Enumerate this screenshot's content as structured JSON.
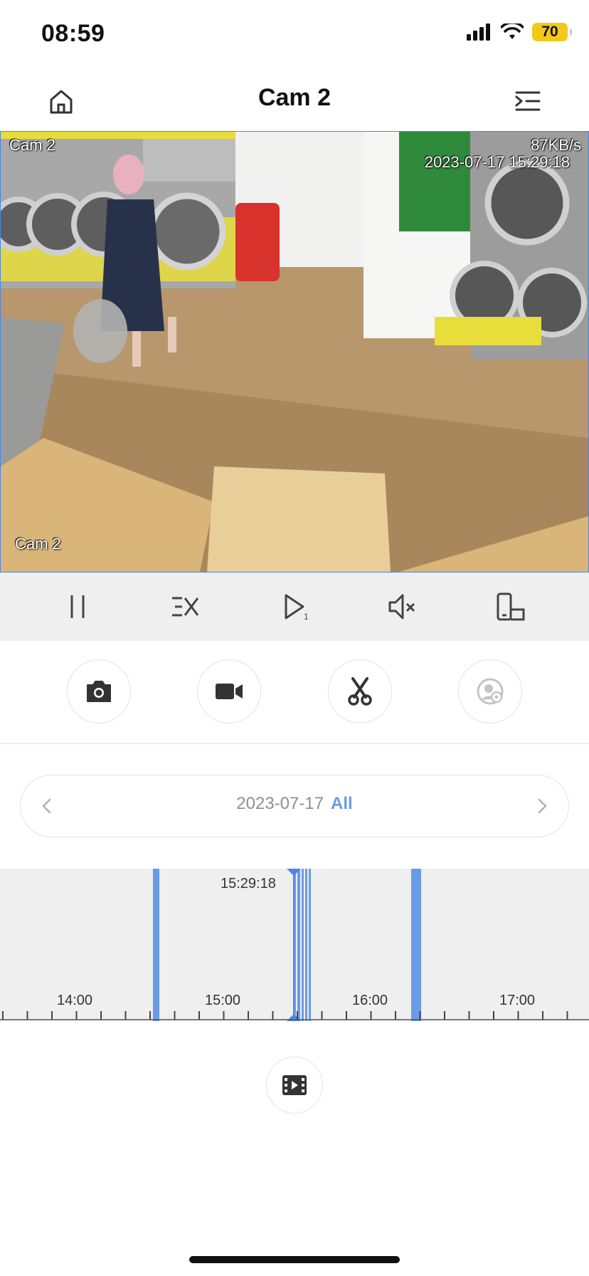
{
  "status_bar": {
    "time": "08:59",
    "battery": "70",
    "icons": [
      "signal-icon",
      "wifi-icon",
      "battery-icon"
    ]
  },
  "header": {
    "title": "Cam 2",
    "left_icon": "home-icon",
    "right_icon": "menu-collapse-icon"
  },
  "video": {
    "overlay_channel_top": "Cam 2",
    "overlay_bitrate": "87KB/s",
    "overlay_timestamp": "2023-07-17 15:29:18",
    "overlay_channel_bottom": "Cam 2",
    "border_color": "#4a86e8"
  },
  "controls": {
    "items": [
      "pause-icon",
      "stream-quality-icon",
      "playback-speed-icon",
      "mute-icon",
      "rotate-screen-icon"
    ]
  },
  "tools": {
    "items": [
      "snapshot-icon",
      "record-icon",
      "clip-icon",
      "face-detect-icon"
    ]
  },
  "date_selector": {
    "date": "2023-07-17",
    "filter": "All",
    "accent": "#6a9be8"
  },
  "timeline": {
    "current_time": "15:29:18",
    "ticks": [
      "14:00",
      "15:00",
      "16:00",
      "17:00"
    ],
    "recording_color": "#6a9be8"
  },
  "footer": {
    "icon": "video-list-icon"
  }
}
